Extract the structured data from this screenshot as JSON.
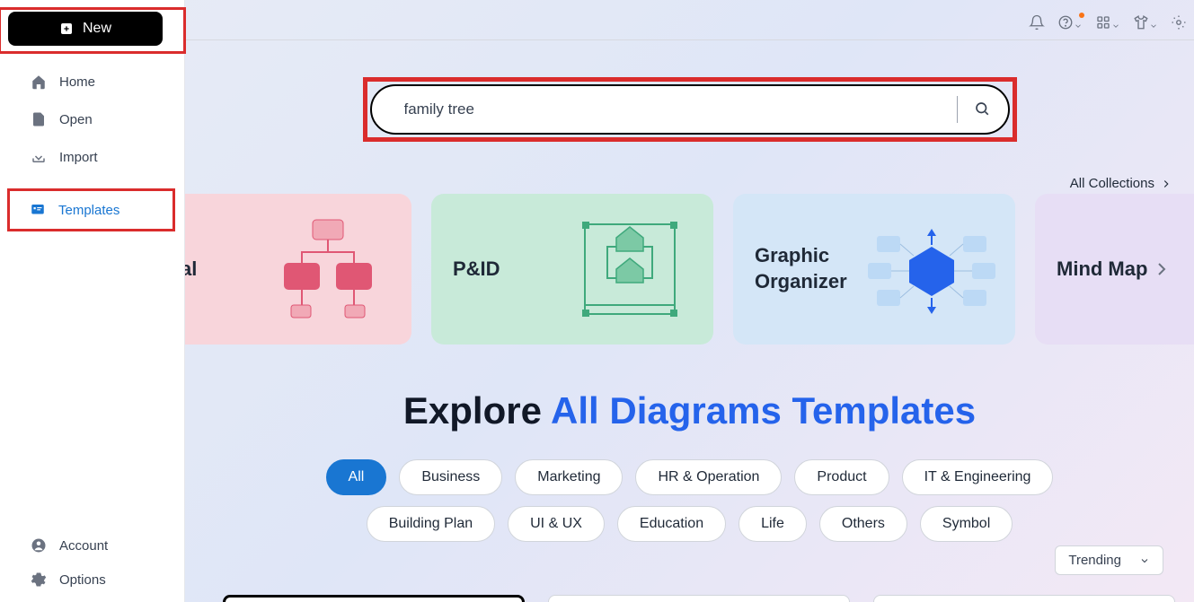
{
  "sidebar": {
    "new_label": "New",
    "items": [
      {
        "label": "Home"
      },
      {
        "label": "Open"
      },
      {
        "label": "Import"
      },
      {
        "label": "Templates"
      }
    ],
    "bottom": [
      {
        "label": "Account"
      },
      {
        "label": "Options"
      }
    ]
  },
  "search": {
    "value": "family tree",
    "placeholder": ""
  },
  "all_collections_label": "All Collections",
  "carousel": {
    "items": [
      {
        "label": "ional"
      },
      {
        "label": "P&ID"
      },
      {
        "label": "Graphic Organizer"
      },
      {
        "label": "Mind Map"
      }
    ]
  },
  "headline": {
    "prefix": "Explore ",
    "accent": "All Diagrams Templates"
  },
  "chips": [
    "All",
    "Business",
    "Marketing",
    "HR & Operation",
    "Product",
    "IT & Engineering",
    "Building Plan",
    "UI & UX",
    "Education",
    "Life",
    "Others",
    "Symbol"
  ],
  "sort": {
    "label": "Trending"
  }
}
